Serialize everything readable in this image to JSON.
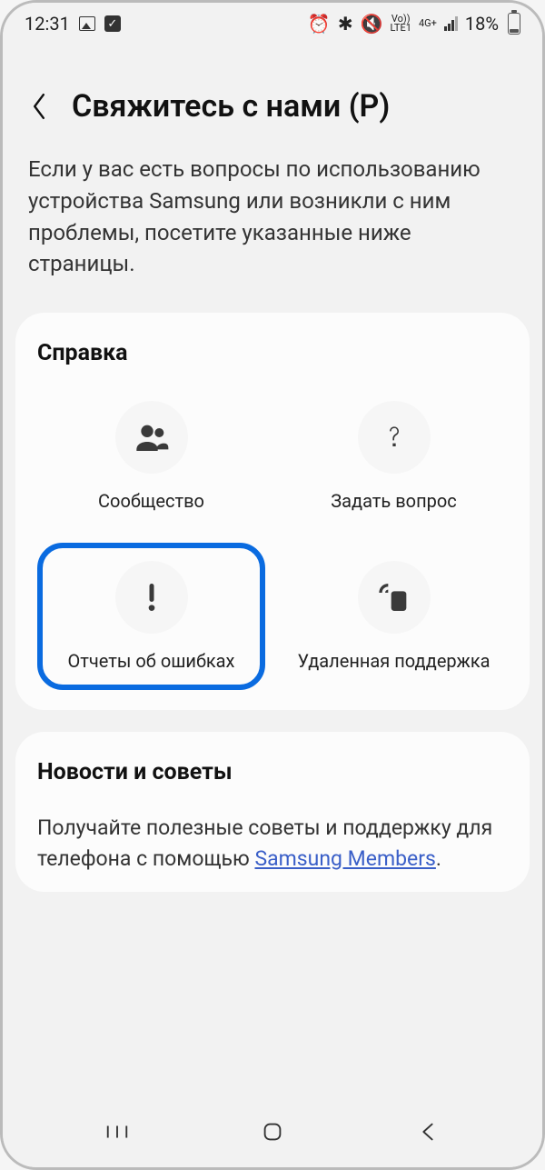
{
  "status": {
    "time": "12:31",
    "battery_pct": "18%",
    "net1": "Vo))",
    "net1b": "LTE1",
    "net2": "4G+"
  },
  "header": {
    "title": "Свяжитесь с нами (P)"
  },
  "intro": "Если у вас есть вопросы по использованию устройства Samsung или возникли с ним проблемы, посетите указанные ниже страницы.",
  "help": {
    "title": "Справка",
    "items": [
      {
        "label": "Сообщество"
      },
      {
        "label": "Задать вопрос"
      },
      {
        "label": "Отчеты об ошибках"
      },
      {
        "label": "Удаленная поддержка"
      }
    ]
  },
  "news": {
    "title": "Новости и советы",
    "text_before": "Получайте полезные советы и поддержку для телефона с помощью ",
    "link": "Samsung Members",
    "text_after": "."
  }
}
